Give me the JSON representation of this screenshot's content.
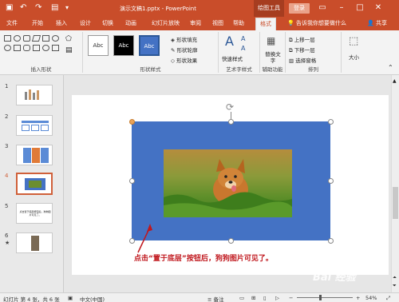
{
  "titlebar": {
    "title": "演示文稿1.pptx - PowerPoint",
    "context_tab": "绘图工具",
    "login": "登录",
    "quick_access": [
      "save-icon",
      "undo-icon",
      "redo-icon",
      "present-icon"
    ]
  },
  "tabs": [
    "文件",
    "开始",
    "插入",
    "设计",
    "切换",
    "动画",
    "幻灯片放映",
    "审阅",
    "视图",
    "帮助",
    "格式"
  ],
  "tellme": "告诉我你想要做什么",
  "share": "共享",
  "ribbon": {
    "groups": [
      "插入形状",
      "形状样式",
      "艺术字样式",
      "辅助功能",
      "排列"
    ],
    "style_samples": [
      "Abc",
      "Abc",
      "Abc"
    ],
    "shape_fill": "形状填充",
    "shape_outline": "形状轮廓",
    "shape_effects": "形状效果",
    "quick_styles": "快速样式",
    "alt_text": "替换文字",
    "bring_forward": "上移一层",
    "send_backward": "下移一层",
    "selection_pane": "选择窗格",
    "size": "大小"
  },
  "thumbnails": [
    {
      "num": "1"
    },
    {
      "num": "2"
    },
    {
      "num": "3"
    },
    {
      "num": "4"
    },
    {
      "num": "5",
      "text": "点击置于底层按钮后，狗狗图片可见了。"
    },
    {
      "num": "6",
      "star": "★"
    }
  ],
  "caption": "点击“置于底层”按钮后，狗狗图片可见了。",
  "statusbar": {
    "slide_info": "幻灯片 第 4 张，共 6 张",
    "language": "中文(中国)",
    "notes": "备注",
    "zoom": "54%"
  },
  "watermark": "Bai 经验"
}
